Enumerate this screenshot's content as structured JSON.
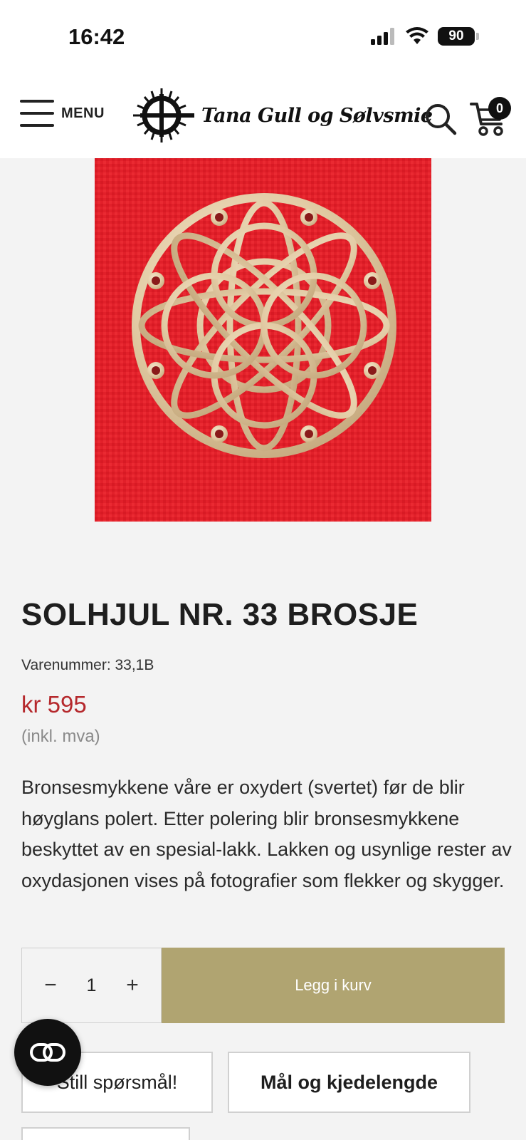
{
  "status_bar": {
    "time": "16:42",
    "battery": "90"
  },
  "header": {
    "menu_label": "MENU",
    "logo_text": "Tana Gull og Sølvsmie",
    "cart_count": "0"
  },
  "product": {
    "title": "SOLHJUL NR. 33 BROSJE",
    "sku": "Varenummer: 33,1B",
    "price": "kr 595",
    "vat_note": "(inkl. mva)",
    "description": "Bronsesmykkene våre er oxydert (svertet) før de blir høyglans polert. Etter polering blir bronsesmykkene beskyttet av en spesial-lakk. Lakken og usynlige rester av oxydasjonen vises på fotografier som flekker og skygger."
  },
  "cart_form": {
    "quantity": "1",
    "add_to_cart_label": "Legg i kurv"
  },
  "actions": {
    "ask_label": "Still spørsmål!",
    "size_label": "Mål og kjedelengde"
  },
  "colors": {
    "accent": "#b0a471",
    "price": "#b5282c",
    "image_background": "#e2202a"
  }
}
